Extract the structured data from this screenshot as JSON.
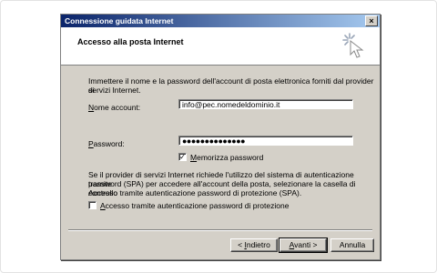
{
  "window": {
    "title": "Connessione guidata Internet"
  },
  "header": {
    "title": "Accesso alla posta Internet"
  },
  "intro_text_1": "Immettere il nome e la password dell'account di posta elettronica forniti dal provider di",
  "intro_text_2": "servizi Internet.",
  "account": {
    "label": "Nome account:",
    "value": "info@pec.nomedeldominio.it"
  },
  "password": {
    "label": "Password:",
    "masked_value": "●●●●●●●●●●●●●●"
  },
  "remember": {
    "label": "Memorizza password",
    "checked": true
  },
  "spa_text_1": "Se il provider di servizi Internet richiede l'utilizzo del sistema di autenticazione tramite",
  "spa_text_2": "password (SPA) per accedere all'account della posta, selezionare la casella di controllo",
  "spa_text_3": "Accesso tramite autenticazione password di protezione (SPA).",
  "spa_checkbox": {
    "label": "Accesso tramite autenticazione password di protezione",
    "checked": false
  },
  "buttons": {
    "back": "< Indietro",
    "next": "Avanti >",
    "cancel": "Annulla"
  },
  "icons": {
    "close": "close-icon",
    "wizard": "wizard-icon",
    "check": "check-icon"
  }
}
